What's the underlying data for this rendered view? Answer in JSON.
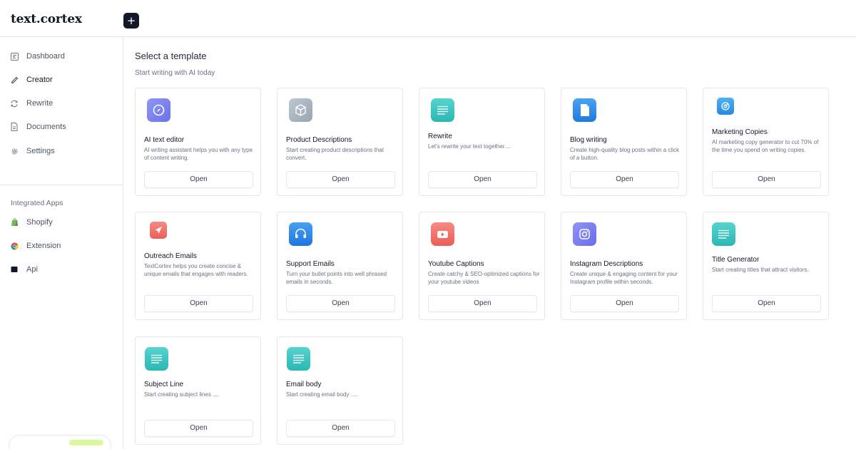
{
  "app": {
    "logo": "text.cortex",
    "new_button": "+"
  },
  "sidebar": {
    "items": [
      {
        "label": "Dashboard",
        "icon": "dashboard-icon"
      },
      {
        "label": "Creator",
        "icon": "pen-icon"
      },
      {
        "label": "Rewrite",
        "icon": "refresh-icon"
      },
      {
        "label": "Documents",
        "icon": "document-icon"
      },
      {
        "label": "Settings",
        "icon": "gear-icon"
      }
    ],
    "integrations_title": "Integrated Apps",
    "integrations": [
      {
        "label": "Shopify",
        "icon": "shopify-icon"
      },
      {
        "label": "Extension",
        "icon": "chrome-icon"
      },
      {
        "label": "Api",
        "icon": "api-icon"
      }
    ]
  },
  "main": {
    "title": "Select a template",
    "subtitle": "Start writing with AI today",
    "open_label": "Open",
    "templates": [
      {
        "title": "AI text editor",
        "desc": "AI writing assistant helps you with any type of content writing.",
        "icon": "compass-icon",
        "color": "#7c83f2"
      },
      {
        "title": "Product Descriptions",
        "desc": "Start creating product descriptions that convert.",
        "icon": "box-icon",
        "color": "#a9b6c2"
      },
      {
        "title": "Rewrite",
        "desc": "Let's rewrite your text together....",
        "icon": "lines-icon",
        "color": "#3cc7c3"
      },
      {
        "title": "Blog writing",
        "desc": "Create high-quality blog posts within a click of a button.",
        "icon": "page-icon",
        "color": "#2f8ee8"
      },
      {
        "title": "Marketing Copies",
        "desc": "AI marketing copy generator to cut 70% of the time you spend on writing copies.",
        "icon": "target-icon",
        "color": "#3aa0ee"
      },
      {
        "title": "Outreach Emails",
        "desc": "TextCortex helps you create concise & unique emails that engages with readers.",
        "icon": "send-icon",
        "color": "#f0716c"
      },
      {
        "title": "Support Emails",
        "desc": "Turn your bullet points into well phrased emails in seconds.",
        "icon": "headset-icon",
        "color": "#2f86e8"
      },
      {
        "title": "Youtube Captions",
        "desc": "Create catchy & SEO-optimized captions for your youtube videos",
        "icon": "youtube-icon",
        "color": "#f0706b"
      },
      {
        "title": "Instagram Descriptions",
        "desc": "Create unique & engaging content for your Instagram profile within seconds.",
        "icon": "instagram-icon",
        "color": "#7a7ef2"
      },
      {
        "title": "Title Generator",
        "desc": "Start creating titles that attract visitors.",
        "icon": "lines-icon",
        "color": "#3cc7c3"
      },
      {
        "title": "Subject Line",
        "desc": "Start creating subject lines ....",
        "icon": "lines-icon",
        "color": "#3cc7c3"
      },
      {
        "title": "Email body",
        "desc": "Start creating email body ....",
        "icon": "lines-icon",
        "color": "#3cc7c3"
      }
    ]
  }
}
